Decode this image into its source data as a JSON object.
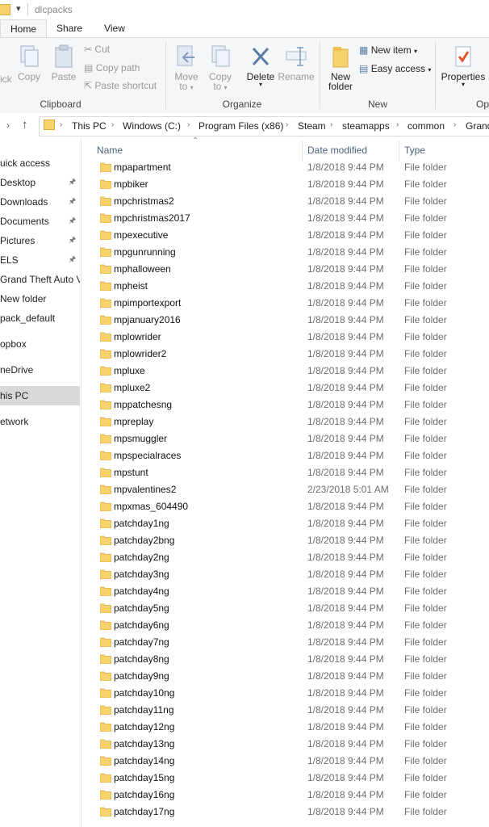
{
  "window": {
    "title": "dlcpacks"
  },
  "ribbon_tabs": [
    "Home",
    "Share",
    "View"
  ],
  "clipboard": {
    "pin_quick": "ick",
    "copy": "Copy",
    "paste": "Paste",
    "cut": "Cut",
    "copy_path": "Copy path",
    "paste_shortcut": "Paste shortcut",
    "group_label": "Clipboard"
  },
  "organize": {
    "move_to_1": "Move",
    "move_to_2": "to",
    "copy_to_1": "Copy",
    "copy_to_2": "to",
    "delete": "Delete",
    "rename": "Rename",
    "group_label": "Organize"
  },
  "new": {
    "new_folder_1": "New",
    "new_folder_2": "folder",
    "new_item": "New item",
    "easy_access": "Easy access",
    "group_label": "New"
  },
  "open": {
    "properties": "Properties",
    "group_label": "Op"
  },
  "breadcrumb": [
    "This PC",
    "Windows (C:)",
    "Program Files (x86)",
    "Steam",
    "steamapps",
    "common",
    "Grand"
  ],
  "nav_items": [
    {
      "label": "uick access",
      "pinned": false
    },
    {
      "label": "Desktop",
      "pinned": true
    },
    {
      "label": "Downloads",
      "pinned": true
    },
    {
      "label": "Documents",
      "pinned": true
    },
    {
      "label": "Pictures",
      "pinned": true
    },
    {
      "label": "ELS",
      "pinned": true
    },
    {
      "label": "Grand Theft Auto V",
      "pinned": false
    },
    {
      "label": "New folder",
      "pinned": false
    },
    {
      "label": "pack_default",
      "pinned": false
    },
    {
      "label": "opbox",
      "pinned": false
    },
    {
      "label": "neDrive",
      "pinned": false
    },
    {
      "label": "his PC",
      "pinned": false,
      "selected": true
    },
    {
      "label": "etwork",
      "pinned": false
    }
  ],
  "columns": {
    "name": "Name",
    "date": "Date modified",
    "type": "Type"
  },
  "files": [
    {
      "name": "mpapartment",
      "date": "1/8/2018 9:44 PM",
      "type": "File folder"
    },
    {
      "name": "mpbiker",
      "date": "1/8/2018 9:44 PM",
      "type": "File folder"
    },
    {
      "name": "mpchristmas2",
      "date": "1/8/2018 9:44 PM",
      "type": "File folder"
    },
    {
      "name": "mpchristmas2017",
      "date": "1/8/2018 9:44 PM",
      "type": "File folder"
    },
    {
      "name": "mpexecutive",
      "date": "1/8/2018 9:44 PM",
      "type": "File folder"
    },
    {
      "name": "mpgunrunning",
      "date": "1/8/2018 9:44 PM",
      "type": "File folder"
    },
    {
      "name": "mphalloween",
      "date": "1/8/2018 9:44 PM",
      "type": "File folder"
    },
    {
      "name": "mpheist",
      "date": "1/8/2018 9:44 PM",
      "type": "File folder"
    },
    {
      "name": "mpimportexport",
      "date": "1/8/2018 9:44 PM",
      "type": "File folder"
    },
    {
      "name": "mpjanuary2016",
      "date": "1/8/2018 9:44 PM",
      "type": "File folder"
    },
    {
      "name": "mplowrider",
      "date": "1/8/2018 9:44 PM",
      "type": "File folder"
    },
    {
      "name": "mplowrider2",
      "date": "1/8/2018 9:44 PM",
      "type": "File folder"
    },
    {
      "name": "mpluxe",
      "date": "1/8/2018 9:44 PM",
      "type": "File folder"
    },
    {
      "name": "mpluxe2",
      "date": "1/8/2018 9:44 PM",
      "type": "File folder"
    },
    {
      "name": "mppatchesng",
      "date": "1/8/2018 9:44 PM",
      "type": "File folder"
    },
    {
      "name": "mpreplay",
      "date": "1/8/2018 9:44 PM",
      "type": "File folder"
    },
    {
      "name": "mpsmuggler",
      "date": "1/8/2018 9:44 PM",
      "type": "File folder"
    },
    {
      "name": "mpspecialraces",
      "date": "1/8/2018 9:44 PM",
      "type": "File folder"
    },
    {
      "name": "mpstunt",
      "date": "1/8/2018 9:44 PM",
      "type": "File folder"
    },
    {
      "name": "mpvalentines2",
      "date": "2/23/2018 5:01 AM",
      "type": "File folder"
    },
    {
      "name": "mpxmas_604490",
      "date": "1/8/2018 9:44 PM",
      "type": "File folder"
    },
    {
      "name": "patchday1ng",
      "date": "1/8/2018 9:44 PM",
      "type": "File folder"
    },
    {
      "name": "patchday2bng",
      "date": "1/8/2018 9:44 PM",
      "type": "File folder"
    },
    {
      "name": "patchday2ng",
      "date": "1/8/2018 9:44 PM",
      "type": "File folder"
    },
    {
      "name": "patchday3ng",
      "date": "1/8/2018 9:44 PM",
      "type": "File folder"
    },
    {
      "name": "patchday4ng",
      "date": "1/8/2018 9:44 PM",
      "type": "File folder"
    },
    {
      "name": "patchday5ng",
      "date": "1/8/2018 9:44 PM",
      "type": "File folder"
    },
    {
      "name": "patchday6ng",
      "date": "1/8/2018 9:44 PM",
      "type": "File folder"
    },
    {
      "name": "patchday7ng",
      "date": "1/8/2018 9:44 PM",
      "type": "File folder"
    },
    {
      "name": "patchday8ng",
      "date": "1/8/2018 9:44 PM",
      "type": "File folder"
    },
    {
      "name": "patchday9ng",
      "date": "1/8/2018 9:44 PM",
      "type": "File folder"
    },
    {
      "name": "patchday10ng",
      "date": "1/8/2018 9:44 PM",
      "type": "File folder"
    },
    {
      "name": "patchday11ng",
      "date": "1/8/2018 9:44 PM",
      "type": "File folder"
    },
    {
      "name": "patchday12ng",
      "date": "1/8/2018 9:44 PM",
      "type": "File folder"
    },
    {
      "name": "patchday13ng",
      "date": "1/8/2018 9:44 PM",
      "type": "File folder"
    },
    {
      "name": "patchday14ng",
      "date": "1/8/2018 9:44 PM",
      "type": "File folder"
    },
    {
      "name": "patchday15ng",
      "date": "1/8/2018 9:44 PM",
      "type": "File folder"
    },
    {
      "name": "patchday16ng",
      "date": "1/8/2018 9:44 PM",
      "type": "File folder"
    },
    {
      "name": "patchday17ng",
      "date": "1/8/2018 9:44 PM",
      "type": "File folder"
    }
  ]
}
